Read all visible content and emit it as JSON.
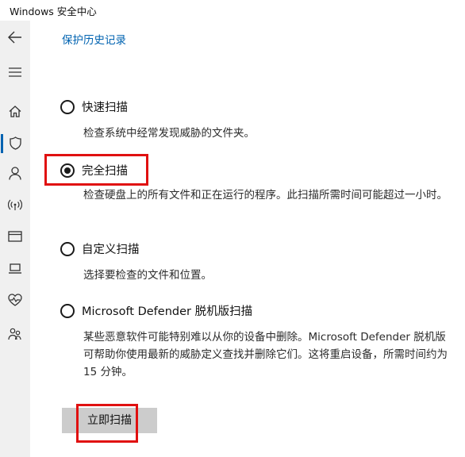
{
  "window": {
    "title": "Windows 安全中心"
  },
  "sidebar": {
    "items": [
      {
        "icon": "back-arrow-icon"
      },
      {
        "icon": "menu-icon"
      },
      {
        "icon": "home-icon"
      },
      {
        "icon": "shield-icon",
        "active": true
      },
      {
        "icon": "account-icon"
      },
      {
        "icon": "wifi-icon"
      },
      {
        "icon": "browser-icon"
      },
      {
        "icon": "laptop-icon"
      },
      {
        "icon": "heart-pulse-icon"
      },
      {
        "icon": "family-icon"
      }
    ],
    "active_color": "#0063b1"
  },
  "main": {
    "breadcrumb": "保护历史记录",
    "scan_options": [
      {
        "label": "快速扫描",
        "description": "检查系统中经常发现威胁的文件夹。",
        "selected": false
      },
      {
        "label": "完全扫描",
        "description": "检查硬盘上的所有文件和正在运行的程序。此扫描所需时间可能超过一小时。",
        "selected": true,
        "highlighted": true
      },
      {
        "label": "自定义扫描",
        "description": "选择要检查的文件和位置。",
        "selected": false
      },
      {
        "label": "Microsoft Defender 脱机版扫描",
        "description": "某些恶意软件可能特别难以从你的设备中删除。Microsoft Defender 脱机版可帮助你使用最新的威胁定义查找并删除它们。这将重启设备，所需时间约为 15 分钟。",
        "selected": false
      }
    ],
    "scan_button": {
      "label": "立即扫描",
      "highlighted": true
    }
  },
  "colors": {
    "link": "#0063b1",
    "highlight": "#e01010",
    "sidebar_bg": "#f0f0f0",
    "button_bg": "#cccccc"
  }
}
